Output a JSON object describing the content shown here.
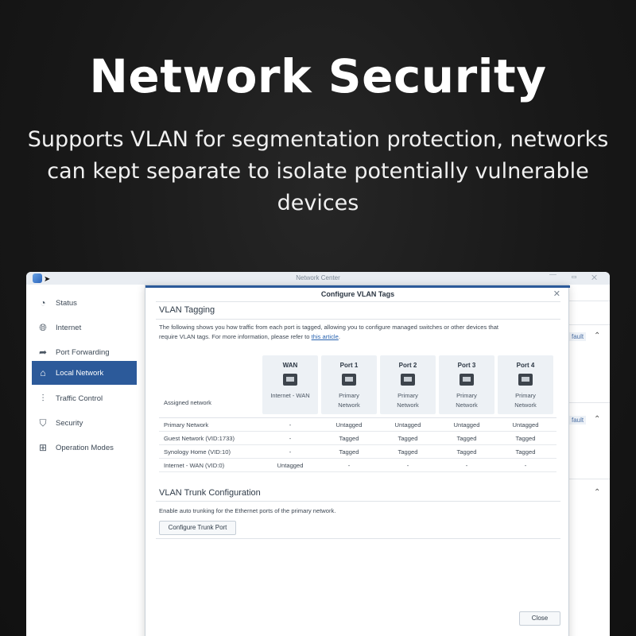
{
  "hero": {
    "title": "Network Security",
    "subtitle_line1": "Supports VLAN for segmentation protection, networks",
    "subtitle_line2": "can kept separate to isolate potentially vulnerable",
    "subtitle_line3": "devices"
  },
  "window": {
    "title": "Network Center",
    "controls": "⎺ ▭ ✕"
  },
  "sidebar": {
    "items": [
      {
        "label": "Status",
        "icon": "status-icon"
      },
      {
        "label": "Internet",
        "icon": "globe-icon"
      },
      {
        "label": "Port Forwarding",
        "icon": "arrow-icon"
      },
      {
        "label": "Local Network",
        "icon": "home-network-icon",
        "active": true
      },
      {
        "label": "Traffic Control",
        "icon": "sliders-icon"
      },
      {
        "label": "Security",
        "icon": "shield-icon"
      },
      {
        "label": "Operation Modes",
        "icon": "router-icon"
      }
    ]
  },
  "background_panel": {
    "tag1": "fault",
    "tag2": "fault"
  },
  "dialog": {
    "title": "Configure VLAN Tags",
    "section1_title": "VLAN Tagging",
    "desc_line1": "The following shows you how traffic from each port is tagged, allowing you to configure managed switches or other devices that",
    "desc_line2_pre": "require VLAN tags. For more information, please refer to ",
    "desc_link": "this article",
    "desc_line2_post": ".",
    "assigned_label": "Assigned network",
    "ports": [
      {
        "name": "WAN",
        "net1": "Internet - WAN",
        "net2": ""
      },
      {
        "name": "Port 1",
        "net1": "Primary",
        "net2": "Network"
      },
      {
        "name": "Port 2",
        "net1": "Primary",
        "net2": "Network"
      },
      {
        "name": "Port 3",
        "net1": "Primary",
        "net2": "Network"
      },
      {
        "name": "Port 4",
        "net1": "Primary",
        "net2": "Network"
      }
    ],
    "rows": [
      {
        "name": "Primary Network",
        "cells": [
          "-",
          "Untagged",
          "Untagged",
          "Untagged",
          "Untagged"
        ]
      },
      {
        "name": "Guest Network (VID:1733)",
        "cells": [
          "-",
          "Tagged",
          "Tagged",
          "Tagged",
          "Tagged"
        ]
      },
      {
        "name": "Synology Home (VID:10)",
        "cells": [
          "-",
          "Tagged",
          "Tagged",
          "Tagged",
          "Tagged"
        ]
      },
      {
        "name": "Internet - WAN (VID:0)",
        "cells": [
          "Untagged",
          "-",
          "-",
          "-",
          "-"
        ]
      }
    ],
    "section2_title": "VLAN Trunk Configuration",
    "trunk_desc": "Enable auto trunking for the Ethernet ports of the primary network.",
    "trunk_button": "Configure Trunk Port",
    "close_button": "Close"
  },
  "colors": {
    "accent": "#2c5a9a",
    "card": "#edf1f5"
  }
}
